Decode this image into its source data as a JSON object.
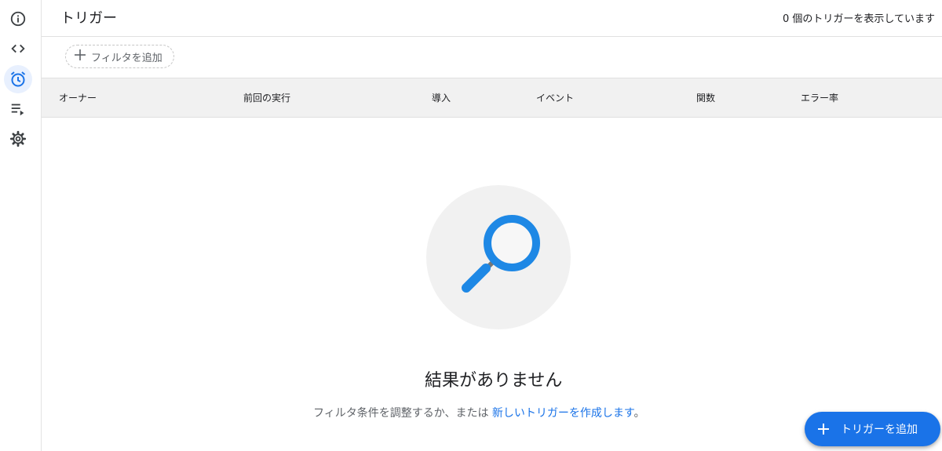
{
  "header": {
    "title": "トリガー",
    "count_text": "0 個のトリガーを表示しています"
  },
  "filter": {
    "add_filter_label": "フィルタを追加"
  },
  "table": {
    "columns": [
      "オーナー",
      "前回の実行",
      "導入",
      "イベント",
      "関数",
      "エラー率"
    ]
  },
  "empty_state": {
    "title": "結果がありません",
    "description_prefix": "フィルタ条件を調整するか、または ",
    "description_link": "新しいトリガーを作成します",
    "description_suffix": "。"
  },
  "fab": {
    "label": "トリガーを追加"
  },
  "sidebar": {
    "items": [
      {
        "icon": "info-icon"
      },
      {
        "icon": "code-icon"
      },
      {
        "icon": "alarm-clock-icon",
        "active": true
      },
      {
        "icon": "playlist-play-icon"
      },
      {
        "icon": "gear-icon"
      }
    ]
  },
  "colors": {
    "accent": "#1a73e8",
    "active_bg": "#e8f0fe",
    "table_header_bg": "#f1f1f1",
    "empty_icon_blue": "#1e88e5"
  }
}
